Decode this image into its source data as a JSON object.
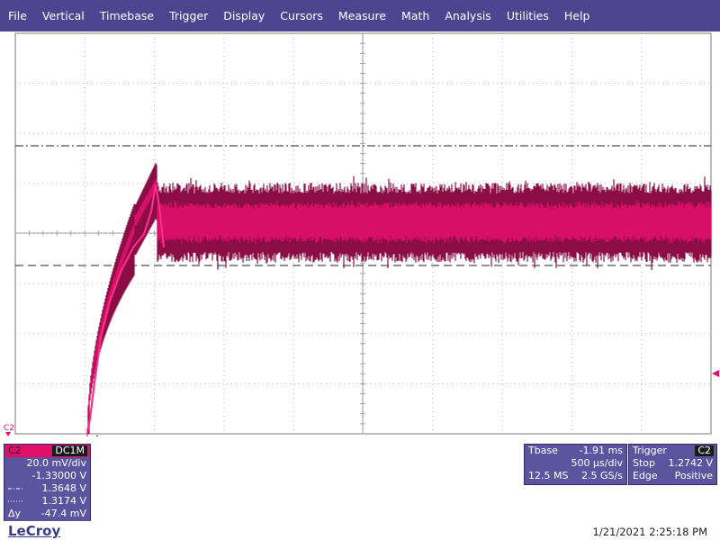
{
  "menu": [
    "File",
    "Vertical",
    "Timebase",
    "Trigger",
    "Display",
    "Cursors",
    "Measure",
    "Math",
    "Analysis",
    "Utilities",
    "Help"
  ],
  "colors": {
    "menubar": "#4d4590",
    "trace": "#e0106a",
    "panel": "#5b55a0",
    "grid": "#9a9a9a"
  },
  "channel_marker": "C2",
  "channel_panel": {
    "name": "C2",
    "coupling": "DC1M",
    "scale": "20.0 mV/div",
    "offset": "-1.33000 V",
    "cursor1_icon": "dash-dot-line-icon",
    "cursor1_value": "1.3648 V",
    "cursor2_icon": "dotted-line-icon",
    "cursor2_value": "1.3174 V",
    "delta_label": "Δy",
    "delta_value": "-47.4 mV"
  },
  "timebase_panel": {
    "title": "Tbase",
    "delay": "-1.91 ms",
    "scale": "500 µs/div",
    "samples": "12.5 MS",
    "rate": "2.5 GS/s"
  },
  "trigger_panel": {
    "title": "Trigger",
    "source": "C2",
    "mode": "Stop",
    "level": "1.2742 V",
    "type": "Edge",
    "slope": "Positive"
  },
  "brand": "LeCroy",
  "timestamp": "1/21/2021 2:25:18 PM"
}
